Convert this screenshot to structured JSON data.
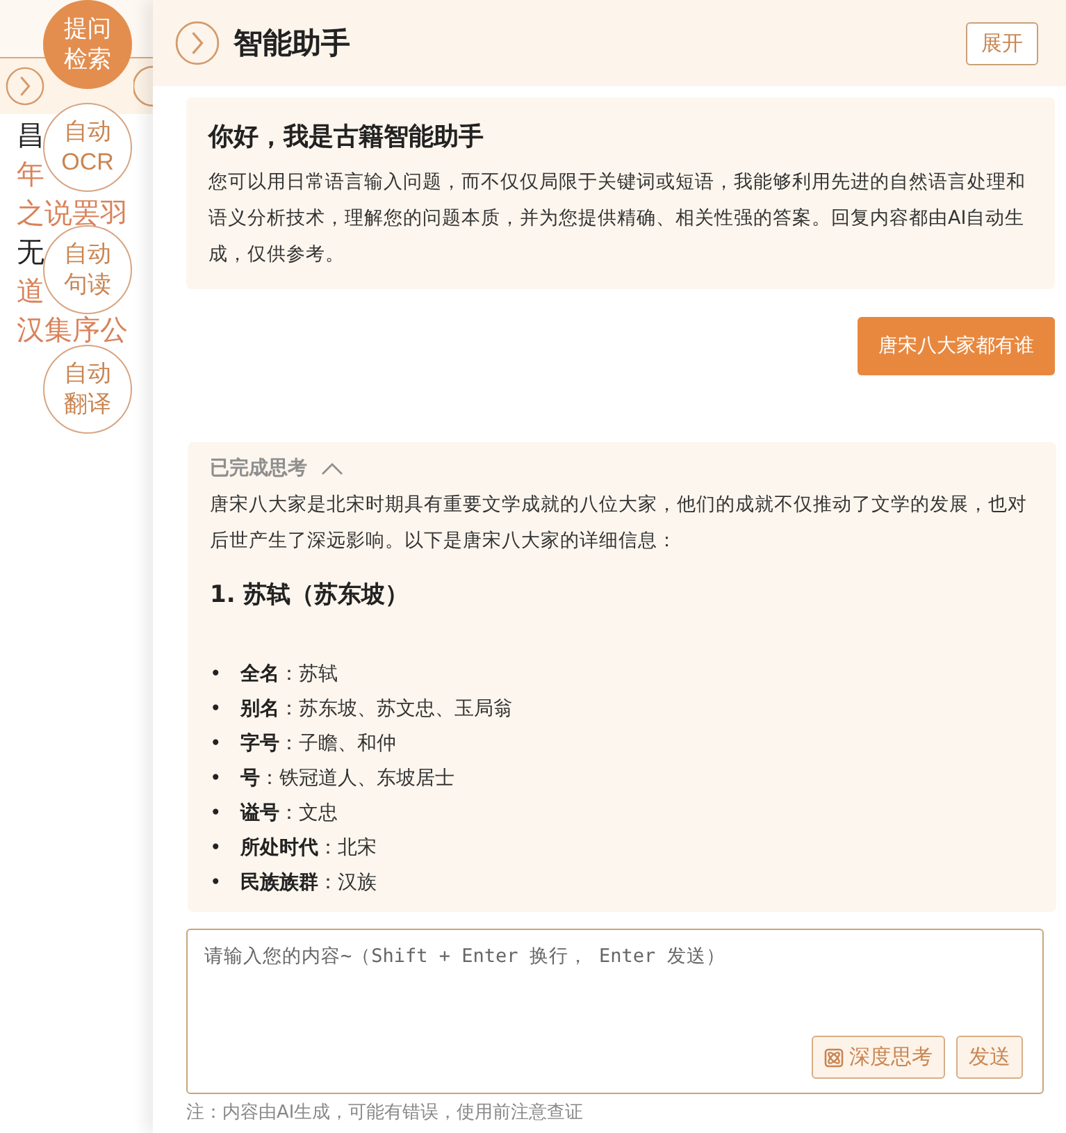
{
  "background_page": {
    "lines": [
      {
        "segments": [
          "昌"
        ],
        "color": "#222222"
      },
      {
        "segments": [
          "年"
        ],
        "color": "#d9825a"
      },
      {
        "segments": [
          "之说罢羽"
        ],
        "color": "#d9825a"
      },
      {
        "segments": [
          "无"
        ],
        "color": "#222222"
      },
      {
        "segments": [
          "道"
        ],
        "color": "#d9825a"
      },
      {
        "segments": [
          "汉集序公"
        ],
        "color": "#d9825a"
      }
    ]
  },
  "floating_tools": [
    {
      "lines": [
        "提问",
        "检索"
      ],
      "selected": true
    },
    {
      "lines": [
        "自动",
        "OCR"
      ],
      "selected": false
    },
    {
      "lines": [
        "自动",
        "句读"
      ],
      "selected": false
    },
    {
      "lines": [
        "自动",
        "翻译"
      ],
      "selected": false
    }
  ],
  "assistant": {
    "title": "智能助手",
    "expand_button": "展开",
    "welcome": {
      "title": "你好，我是古籍智能助手",
      "body": "您可以用日常语言输入问题，而不仅仅局限于关键词或短语，我能够利用先进的自然语言处理和语义分析技术，理解您的问题本质，并为您提供精确、相关性强的答案。回复内容都由AI自动生成，仅供参考。"
    },
    "user_message": "唐宋八大家都有谁",
    "answer": {
      "status": "已完成思考",
      "expanded": true,
      "intro": "唐宋八大家是北宋时期具有重要文学成就的八位大家，他们的成就不仅推动了文学的发展，也对后世产生了深远影响。以下是唐宋八大家的详细信息：",
      "heading": "1. 苏轼（苏东坡）",
      "items": [
        {
          "bullet": "•",
          "term": "全名",
          "value": "：苏轼"
        },
        {
          "bullet": "•",
          "term": "别名",
          "value": "：苏东坡、苏文忠、玉局翁"
        },
        {
          "bullet": "•",
          "term": "字号",
          "value": "：子瞻、和仲"
        },
        {
          "bullet": "•",
          "term": "号",
          "value": "：铁冠道人、东坡居士"
        },
        {
          "bullet": "•",
          "term": "谥号",
          "value": "：文忠"
        },
        {
          "bullet": "•",
          "term": "所处时代",
          "value": "：北宋"
        },
        {
          "bullet": "•",
          "term": "民族族群",
          "value": "：汉族"
        }
      ]
    },
    "input": {
      "placeholder": "请输入您的内容~（Shift + Enter 换行， Enter 发送）",
      "deep_think_button": "深度思考",
      "send_button": "发送"
    },
    "footnote": "注：内容由AI生成，可能有错误，使用前注意查证"
  }
}
